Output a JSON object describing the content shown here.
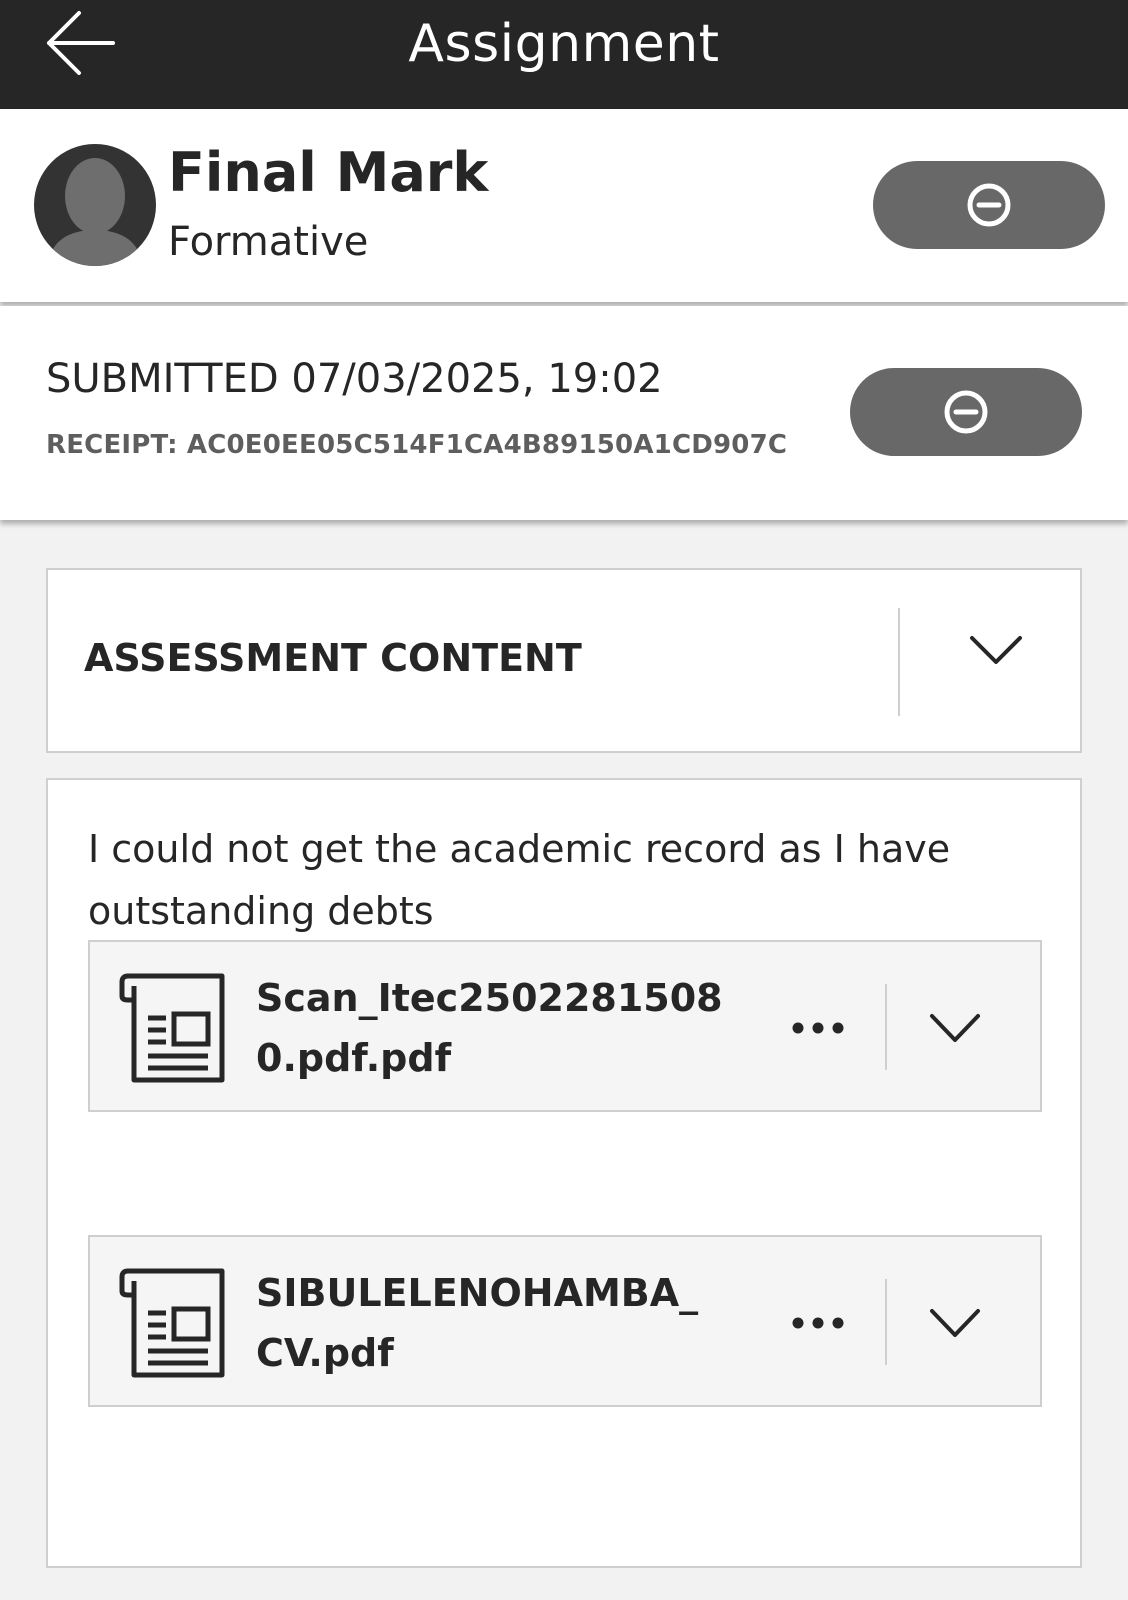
{
  "topbar": {
    "title": "Assignment"
  },
  "header": {
    "title": "Final Mark",
    "subtitle": "Formative"
  },
  "submission": {
    "submitted": "SUBMITTED 07/03/2025, 19:02",
    "receipt": "RECEIPT: AC0E0EE05C514F1CA4B89150A1CD907C"
  },
  "accordion": {
    "title": "ASSESSMENT CONTENT"
  },
  "content": {
    "comment": "I could not get the academic record as I have outstanding debts",
    "files": [
      {
        "name": "Scan_Itec25022815080.pdf.pdf"
      },
      {
        "name": "SIBULELENOHAMBA_CV.pdf"
      }
    ]
  },
  "icons": {
    "back": "arrow-left-icon",
    "pill": "minus-circle-icon",
    "chevron": "chevron-down-icon",
    "file": "document-icon",
    "more": "more-horizontal-icon"
  }
}
